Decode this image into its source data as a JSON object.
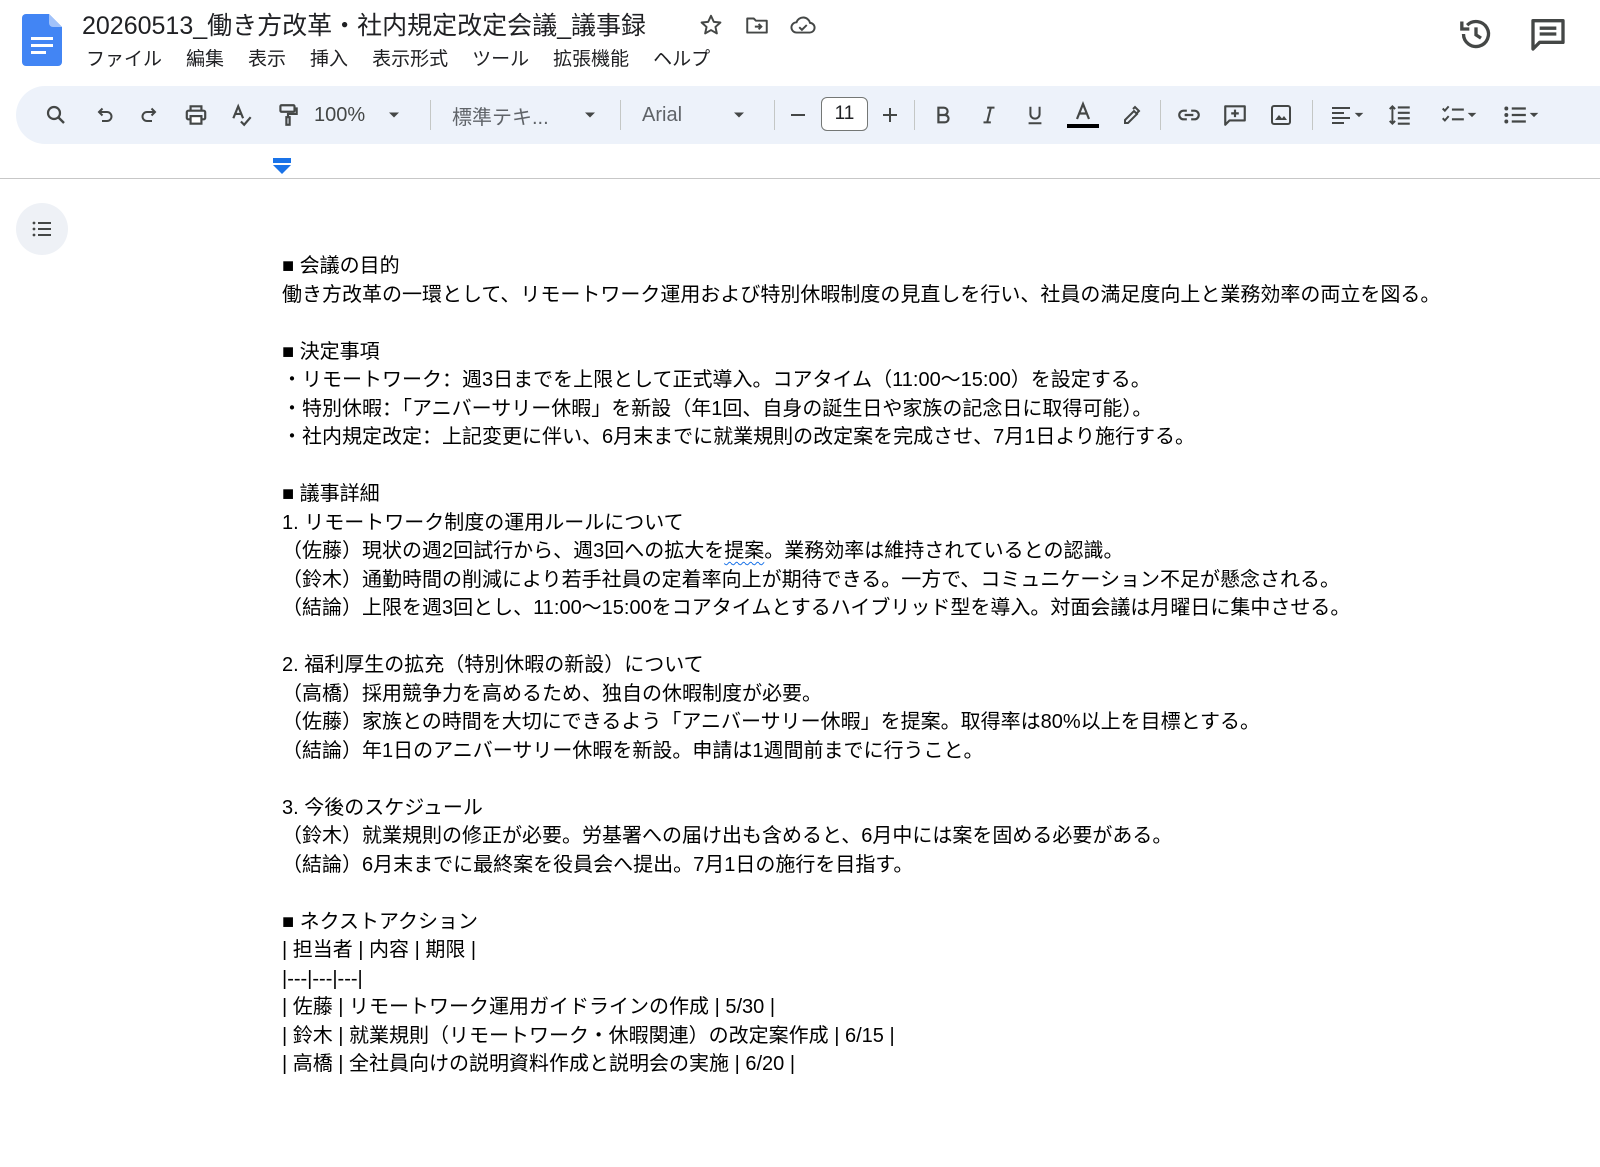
{
  "document": {
    "title": "20260513_働き方改革・社内規定改定会議_議事録"
  },
  "menu": [
    "ファイル",
    "編集",
    "表示",
    "挿入",
    "表示形式",
    "ツール",
    "拡張機能",
    "ヘルプ"
  ],
  "toolbar": {
    "zoom": "100%",
    "style": "標準テキ...",
    "font": "Arial",
    "font_size": "11"
  },
  "content": {
    "purpose_heading": "■ 会議の目的",
    "purpose_text": "働き方改革の一環として、リモートワーク運用および特別休暇制度の見直しを行い、社員の満足度向上と業務効率の両立を図る。",
    "decisions_heading": "■ 決定事項",
    "decisions": [
      "・リモートワーク：週3日までを上限として正式導入。コアタイム（11:00〜15:00）を設定する。",
      "・特別休暇：「アニバーサリー休暇」を新設（年1回、自身の誕生日や家族の記念日に取得可能）。",
      "・社内規定改定：上記変更に伴い、6月末までに就業規則の改定案を完成させ、7月1日より施行する。"
    ],
    "details_heading": "■ 議事詳細",
    "item1_title": "1. リモートワーク制度の運用ルールについて",
    "item1_l1_pre": "（佐藤）現状の週2回試行から、週3回への拡大を",
    "item1_l1_mark": "提案",
    "item1_l1_post": "。業務効率は維持されているとの認識。",
    "item1_l2": "（鈴木）通勤時間の削減により若手社員の定着率向上が期待できる。一方で、コミュニケーション不足が懸念される。",
    "item1_l3": "（結論）上限を週3回とし、11:00〜15:00をコアタイムとするハイブリッド型を導入。対面会議は月曜日に集中させる。",
    "item2_title": "2. 福利厚生の拡充（特別休暇の新設）について",
    "item2_l1": "（高橋）採用競争力を高めるため、独自の休暇制度が必要。",
    "item2_l2": "（佐藤）家族との時間を大切にできるよう「アニバーサリー休暇」を提案。取得率は80%以上を目標とする。",
    "item2_l3": "（結論）年1日のアニバーサリー休暇を新設。申請は1週間前までに行うこと。",
    "item3_title": "3. 今後のスケジュール",
    "item3_l1": "（鈴木）就業規則の修正が必要。労基署への届け出も含めると、6月中には案を固める必要がある。",
    "item3_l2": "（結論）6月末までに最終案を役員会へ提出。7月1日の施行を目指す。",
    "next_heading": "■ ネクストアクション",
    "table_lines": [
      "| 担当者 | 内容 | 期限 |",
      "|---|---|---|",
      "| 佐藤 | リモートワーク運用ガイドラインの作成 | 5/30 |",
      "| 鈴木 | 就業規則（リモートワーク・休暇関連）の改定案作成 | 6/15 |",
      "| 高橋 | 全社員向けの説明資料作成と説明会の実施 | 6/20 |"
    ]
  },
  "colors": {
    "docs_blue": "#4285f4",
    "toolbar_bg": "#edf2fa",
    "ruler_marker": "#1a73e8"
  }
}
